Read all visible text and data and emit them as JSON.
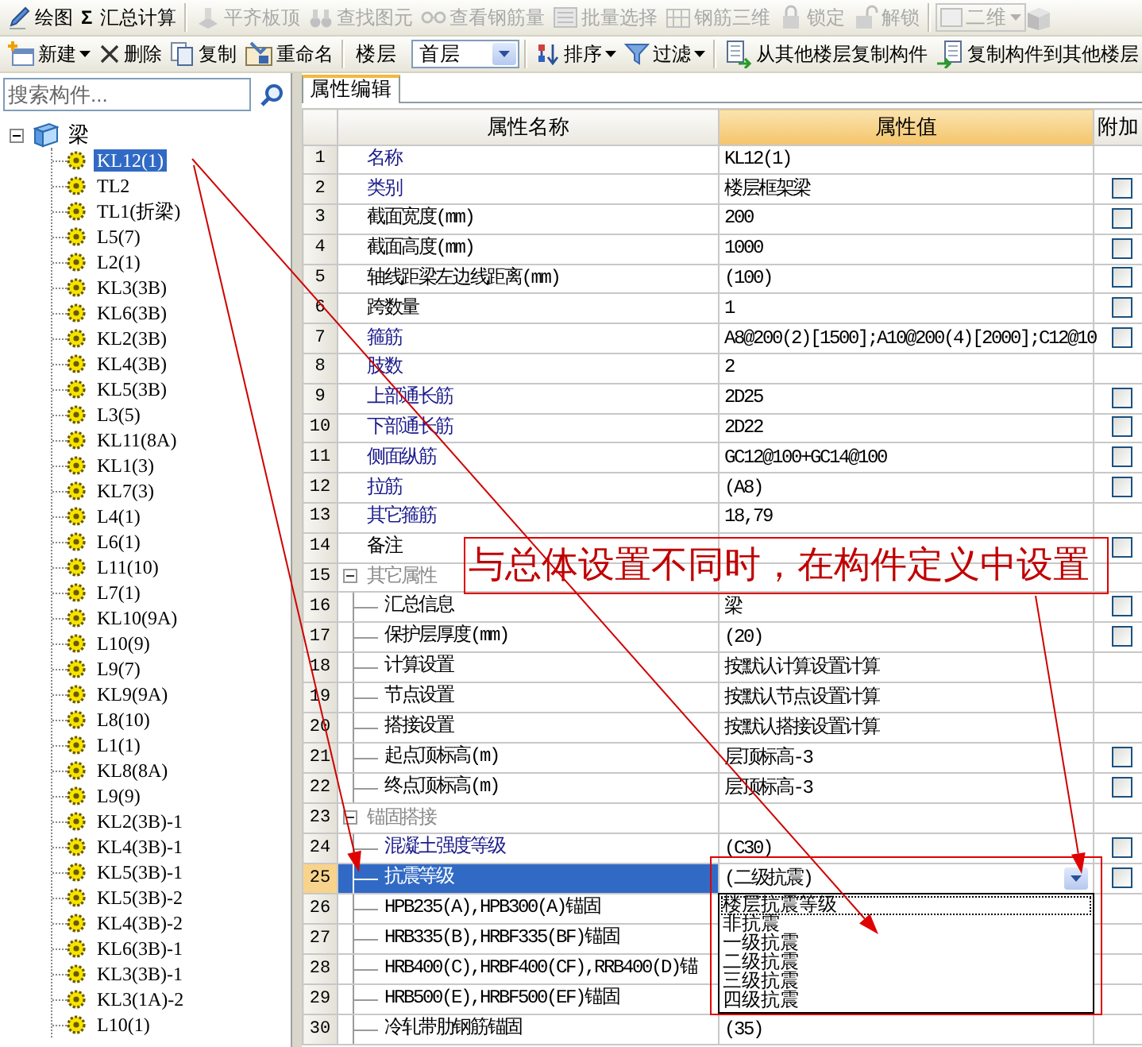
{
  "toolbar_main": [
    {
      "label": "绘图",
      "disabled": false
    },
    {
      "glyph": "Σ",
      "label": "汇总计算",
      "disabled": false
    },
    {
      "label": "平齐板顶",
      "disabled": true
    },
    {
      "label": "查找图元",
      "disabled": true
    },
    {
      "label": "查看钢筋量",
      "disabled": true
    },
    {
      "label": "批量选择",
      "disabled": true
    },
    {
      "label": "钢筋三维",
      "disabled": true
    },
    {
      "label": "锁定",
      "disabled": true
    },
    {
      "label": "解锁",
      "disabled": true
    },
    {
      "kind": "select",
      "label": "二维",
      "disabled": true
    }
  ],
  "toolbar_component": [
    {
      "kind": "button",
      "label": "新建",
      "menu": true
    },
    {
      "kind": "button",
      "label": "删除",
      "menu": false
    },
    {
      "kind": "button",
      "label": "复制",
      "menu": false
    },
    {
      "kind": "button",
      "label": "重命名",
      "menu": false
    },
    {
      "kind": "floor",
      "label": "楼层",
      "value": "首层"
    },
    {
      "kind": "button",
      "label": "排序",
      "menu": true
    },
    {
      "kind": "button",
      "label": "过滤",
      "menu": true
    },
    {
      "kind": "button",
      "label": "从其他楼层复制构件",
      "menu": false
    },
    {
      "kind": "button",
      "label": "复制构件到其他楼层",
      "menu": false
    }
  ],
  "search": {
    "placeholder": "搜索构件..."
  },
  "tree": {
    "label": "梁",
    "expanded": true,
    "children": [
      {
        "label": "KL12(1)",
        "selected": true
      },
      {
        "label": "TL2",
        "selected": false
      },
      {
        "label": "TL1(折梁)",
        "selected": false
      },
      {
        "label": "L5(7)",
        "selected": false
      },
      {
        "label": "L2(1)",
        "selected": false
      },
      {
        "label": "KL3(3B)",
        "selected": false
      },
      {
        "label": "KL6(3B)",
        "selected": false
      },
      {
        "label": "KL2(3B)",
        "selected": false
      },
      {
        "label": "KL4(3B)",
        "selected": false
      },
      {
        "label": "KL5(3B)",
        "selected": false
      },
      {
        "label": "L3(5)",
        "selected": false
      },
      {
        "label": "KL11(8A)",
        "selected": false
      },
      {
        "label": "KL1(3)",
        "selected": false
      },
      {
        "label": "KL7(3)",
        "selected": false
      },
      {
        "label": "L4(1)",
        "selected": false
      },
      {
        "label": "L6(1)",
        "selected": false
      },
      {
        "label": "L11(10)",
        "selected": false
      },
      {
        "label": "L7(1)",
        "selected": false
      },
      {
        "label": "KL10(9A)",
        "selected": false
      },
      {
        "label": "L10(9)",
        "selected": false
      },
      {
        "label": "L9(7)",
        "selected": false
      },
      {
        "label": "KL9(9A)",
        "selected": false
      },
      {
        "label": "L8(10)",
        "selected": false
      },
      {
        "label": "L1(1)",
        "selected": false
      },
      {
        "label": "KL8(8A)",
        "selected": false
      },
      {
        "label": "L9(9)",
        "selected": false
      },
      {
        "label": "KL2(3B)-1",
        "selected": false
      },
      {
        "label": "KL4(3B)-1",
        "selected": false
      },
      {
        "label": "KL5(3B)-1",
        "selected": false
      },
      {
        "label": "KL5(3B)-2",
        "selected": false
      },
      {
        "label": "KL4(3B)-2",
        "selected": false
      },
      {
        "label": "KL6(3B)-1",
        "selected": false
      },
      {
        "label": "KL3(3B)-1",
        "selected": false
      },
      {
        "label": "KL3(1A)-2",
        "selected": false
      },
      {
        "label": "L10(1)",
        "selected": false
      }
    ]
  },
  "tabs": [
    {
      "label": "属性编辑",
      "selected": true
    }
  ],
  "table": {
    "columns": [
      "属性名称",
      "属性值",
      "附加"
    ],
    "rows": [
      {
        "kind": "prop",
        "number": "1",
        "name": "名称",
        "value": "KL12(1)",
        "public": true,
        "selected": false
      },
      {
        "kind": "prop",
        "number": "2",
        "name": "类别",
        "value": "楼层框架梁",
        "public": true,
        "selected": false,
        "extra": {
          "checked": false
        }
      },
      {
        "kind": "prop",
        "number": "3",
        "name": "截面宽度(mm)",
        "value": "200",
        "public": false,
        "selected": false,
        "extra": {
          "checked": false
        }
      },
      {
        "kind": "prop",
        "number": "4",
        "name": "截面高度(mm)",
        "value": "1000",
        "public": false,
        "selected": false,
        "extra": {
          "checked": false
        }
      },
      {
        "kind": "prop",
        "number": "5",
        "name": "轴线距梁左边线距离(mm)",
        "value": "(100)",
        "public": false,
        "selected": false,
        "extra": {
          "checked": false
        }
      },
      {
        "kind": "prop",
        "number": "6",
        "name": "跨数量",
        "value": "1",
        "public": false,
        "selected": false,
        "extra": {
          "checked": false
        }
      },
      {
        "kind": "prop",
        "number": "7",
        "name": "箍筋",
        "value": "A8@200(2)[1500];A10@200(4)[2000];C12@10",
        "public": true,
        "selected": false,
        "extra": {
          "checked": false
        }
      },
      {
        "kind": "prop",
        "number": "8",
        "name": "肢数",
        "value": "2",
        "public": true,
        "selected": false
      },
      {
        "kind": "prop",
        "number": "9",
        "name": "上部通长筋",
        "value": "2D25",
        "public": true,
        "selected": false,
        "extra": {
          "checked": false
        }
      },
      {
        "kind": "prop",
        "number": "10",
        "name": "下部通长筋",
        "value": "2D22",
        "public": true,
        "selected": false,
        "extra": {
          "checked": false
        }
      },
      {
        "kind": "prop",
        "number": "11",
        "name": "侧面纵筋",
        "value": "GC12@100+GC14@100",
        "public": true,
        "selected": false,
        "extra": {
          "checked": false
        }
      },
      {
        "kind": "prop",
        "number": "12",
        "name": "拉筋",
        "value": "(A8)",
        "public": true,
        "selected": false,
        "extra": {
          "checked": false
        }
      },
      {
        "kind": "prop",
        "number": "13",
        "name": "其它箍筋",
        "value": "18,79",
        "public": true,
        "selected": false
      },
      {
        "kind": "prop",
        "number": "14",
        "name": "备注",
        "public": false,
        "selected": false,
        "extra": {
          "checked": false
        }
      },
      {
        "kind": "group",
        "number": "15",
        "name": "其它属性",
        "expanded": true,
        "selected": false,
        "children": [
          {
            "kind": "prop",
            "number": "16",
            "name": "汇总信息",
            "value": "梁",
            "public": false,
            "selected": false,
            "extra": {
              "checked": false
            }
          },
          {
            "kind": "prop",
            "number": "17",
            "name": "保护层厚度(mm)",
            "value": "(20)",
            "public": false,
            "selected": false,
            "extra": {
              "checked": false
            }
          },
          {
            "kind": "prop",
            "number": "18",
            "name": "计算设置",
            "value": "按默认计算设置计算",
            "public": false,
            "selected": false
          },
          {
            "kind": "prop",
            "number": "19",
            "name": "节点设置",
            "value": "按默认节点设置计算",
            "public": false,
            "selected": false
          },
          {
            "kind": "prop",
            "number": "20",
            "name": "搭接设置",
            "value": "按默认搭接设置计算",
            "public": false,
            "selected": false
          },
          {
            "kind": "prop",
            "number": "21",
            "name": "起点顶标高(m)",
            "value": "层顶标高-3",
            "public": false,
            "selected": false,
            "extra": {
              "checked": false
            }
          },
          {
            "kind": "prop",
            "number": "22",
            "name": "终点顶标高(m)",
            "value": "层顶标高-3",
            "public": false,
            "selected": false,
            "extra": {
              "checked": false
            }
          }
        ]
      },
      {
        "kind": "group",
        "number": "23",
        "name": "锚固搭接",
        "expanded": true,
        "selected": false,
        "children": [
          {
            "kind": "prop",
            "number": "24",
            "name": "混凝土强度等级",
            "value": "(C30)",
            "public": true,
            "selected": false,
            "extra": {
              "checked": false
            }
          },
          {
            "kind": "prop",
            "number": "25",
            "name": "抗震等级",
            "value": "(二级抗震)",
            "selected": true,
            "extra": {
              "checked": false
            },
            "options": [
              {
                "label": "楼层抗震等级",
                "focused": true
              },
              {
                "label": "非抗震",
                "focused": false
              },
              {
                "label": "一级抗震",
                "focused": false
              },
              {
                "label": "二级抗震",
                "focused": false
              },
              {
                "label": "三级抗震",
                "focused": false
              },
              {
                "label": "四级抗震",
                "focused": false
              }
            ]
          },
          {
            "kind": "prop",
            "number": "26",
            "name": "HPB235(A),HPB300(A)锚固",
            "public": false,
            "selected": false
          },
          {
            "kind": "prop",
            "number": "27",
            "name": "HRB335(B),HRBF335(BF)锚固",
            "public": false,
            "selected": false
          },
          {
            "kind": "prop",
            "number": "28",
            "name": "HRB400(C),HRBF400(CF),RRB400(D)锚",
            "public": false,
            "selected": false
          },
          {
            "kind": "prop",
            "number": "29",
            "name": "HRB500(E),HRBF500(EF)锚固",
            "public": false,
            "selected": false
          },
          {
            "kind": "prop",
            "number": "30",
            "name": "冷轧带肋钢筋锚固",
            "value": "(35)",
            "public": false,
            "selected": false
          }
        ]
      }
    ]
  },
  "annotation": {
    "text": "与总体设置不同时，在构件定义中设置"
  }
}
